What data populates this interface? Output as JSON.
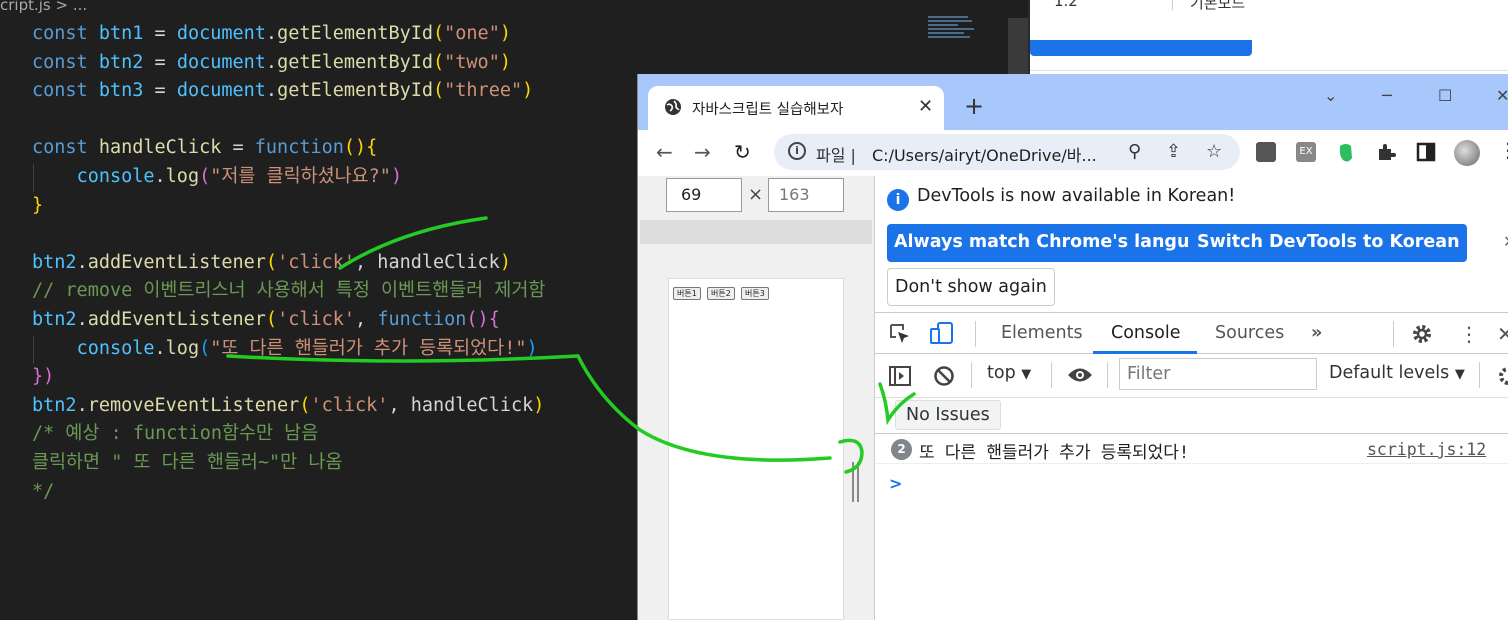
{
  "editor": {
    "breadcrumb": "cript.js > ...",
    "lines": [
      [
        [
          "kw",
          "const "
        ],
        [
          "var",
          "btn1"
        ],
        [
          "pl",
          " = "
        ],
        [
          "var",
          "document"
        ],
        [
          "pl",
          "."
        ],
        [
          "fn",
          "getElementById"
        ],
        [
          "br1",
          "("
        ],
        [
          "str",
          "\"one\""
        ],
        [
          "br1",
          ")"
        ]
      ],
      [
        [
          "kw",
          "const "
        ],
        [
          "var",
          "btn2"
        ],
        [
          "pl",
          " = "
        ],
        [
          "var",
          "document"
        ],
        [
          "pl",
          "."
        ],
        [
          "fn",
          "getElementById"
        ],
        [
          "br1",
          "("
        ],
        [
          "str",
          "\"two\""
        ],
        [
          "br1",
          ")"
        ]
      ],
      [
        [
          "kw",
          "const "
        ],
        [
          "var",
          "btn3"
        ],
        [
          "pl",
          " = "
        ],
        [
          "var",
          "document"
        ],
        [
          "pl",
          "."
        ],
        [
          "fn",
          "getElementById"
        ],
        [
          "br1",
          "("
        ],
        [
          "str",
          "\"three\""
        ],
        [
          "br1",
          ")"
        ]
      ],
      [],
      [
        [
          "kw",
          "const "
        ],
        [
          "fn",
          "handleClick"
        ],
        [
          "pl",
          " = "
        ],
        [
          "kw",
          "function"
        ],
        [
          "br1",
          "(){"
        ]
      ],
      [
        [
          "pl",
          "    "
        ],
        [
          "var",
          "console"
        ],
        [
          "pl",
          "."
        ],
        [
          "fn",
          "log"
        ],
        [
          "br2",
          "("
        ],
        [
          "str",
          "\"저를 클릭하셨나요?\""
        ],
        [
          "br2",
          ")"
        ]
      ],
      [
        [
          "br1",
          "}"
        ]
      ],
      [],
      [
        [
          "var",
          "btn2"
        ],
        [
          "pl",
          "."
        ],
        [
          "fn",
          "addEventListener"
        ],
        [
          "br1",
          "("
        ],
        [
          "str",
          "'click'"
        ],
        [
          "pl",
          ", handleClick"
        ],
        [
          "br1",
          ")"
        ]
      ],
      [
        [
          "cm",
          "// remove 이벤트리스너 사용해서 특정 이벤트핸들러 제거함"
        ]
      ],
      [
        [
          "var",
          "btn2"
        ],
        [
          "pl",
          "."
        ],
        [
          "fn",
          "addEventListener"
        ],
        [
          "br1",
          "("
        ],
        [
          "str",
          "'click'"
        ],
        [
          "pl",
          ", "
        ],
        [
          "kw",
          "function"
        ],
        [
          "br2",
          "(){"
        ]
      ],
      [
        [
          "pl",
          "    "
        ],
        [
          "var",
          "console"
        ],
        [
          "pl",
          "."
        ],
        [
          "fn",
          "log"
        ],
        [
          "br3",
          "("
        ],
        [
          "str",
          "\"또 다른 핸들러가 추가 등록되었다!\""
        ],
        [
          "br3",
          ")"
        ]
      ],
      [
        [
          "br2",
          "})"
        ]
      ],
      [
        [
          "var",
          "btn2"
        ],
        [
          "pl",
          "."
        ],
        [
          "fn",
          "removeEventListener"
        ],
        [
          "br1",
          "("
        ],
        [
          "str",
          "'click'"
        ],
        [
          "pl",
          ", handleClick"
        ],
        [
          "br1",
          ")"
        ]
      ],
      [
        [
          "cm",
          "/* 예상 : function함수만 남음"
        ]
      ],
      [
        [
          "cm",
          "클릭하면 \" 또 다른 핸들러~\"만 나옴"
        ]
      ],
      [
        [
          "cm",
          "*/"
        ]
      ]
    ]
  },
  "background_page": {
    "text_left": "1.2",
    "text_right": "기본모드"
  },
  "browser": {
    "tab_title": "자바스크립트 실습해보자",
    "tab_close": "✕",
    "new_tab": "+",
    "win_min": "─",
    "win_max": "☐",
    "win_close": "✕",
    "chevron": "⌄",
    "back": "←",
    "forward": "→",
    "reload": "↻",
    "address_scheme": "파일 |",
    "address_url": "C:/Users/airyt/OneDrive/바...",
    "zoom_icon": "⚲",
    "share_icon": "⇪",
    "star_icon": "☆",
    "ext_ex": "EX",
    "menu": "⋮"
  },
  "viewport": {
    "width": "69",
    "times": "×",
    "height": "163",
    "buttons": [
      "버튼1",
      "버튼2",
      "버튼3"
    ]
  },
  "devtools": {
    "notice": "DevTools is now available in Korean!",
    "notice_icon": "i",
    "btn_match": "Always match Chrome's language",
    "btn_switch": "Switch DevTools to Korean",
    "btn_dont_show": "Don't show again",
    "notice_close": "✕",
    "tabs": [
      "Elements",
      "Console",
      "Sources"
    ],
    "more_tabs": "»",
    "context": "top",
    "filter_placeholder": "Filter",
    "levels": "Default levels",
    "issues": "No Issues",
    "log": {
      "count": "2",
      "message": "또 다른 핸들러가 추가 등록되었다!",
      "source": "script.js:12"
    },
    "prompt": ">"
  },
  "colors": {
    "annotation": "#22cc22",
    "accent": "#1a73e8",
    "tabstrip": "#a8c7fa"
  }
}
